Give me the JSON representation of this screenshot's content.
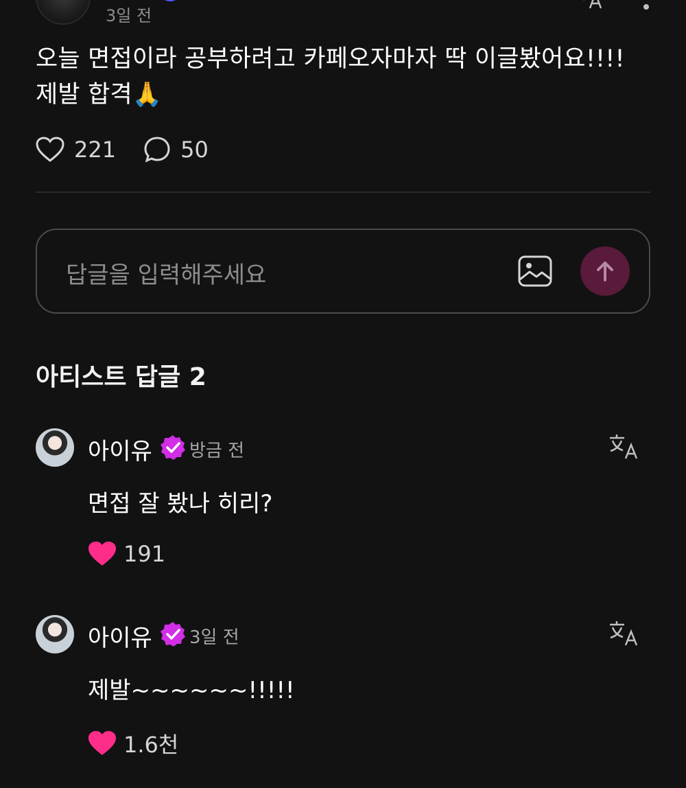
{
  "post": {
    "time": "3일 전",
    "text": "오늘 면접이라 공부하려고 카페오자마자 딱 이글봤어요!!!! 제발 합격🙏",
    "likes": "221",
    "comments": "50"
  },
  "reply_input": {
    "placeholder": "답글을 입력해주세요"
  },
  "section": {
    "title": "아티스트 답글 2"
  },
  "comments": [
    {
      "name": "아이유",
      "time": "방금 전",
      "text": "면접 잘 봤나 히리?",
      "likes": "191"
    },
    {
      "name": "아이유",
      "time": "3일 전",
      "text": "제발~~~~~~!!!!!",
      "likes": "1.6천"
    }
  ],
  "colors": {
    "background": "#121212",
    "heart": "#ff2d8a",
    "verified": "#d12ee6",
    "send_button": "#5a1a3a"
  },
  "icons": [
    "heart-outline-icon",
    "comment-icon",
    "image-icon",
    "send-arrow-icon",
    "translate-icon",
    "more-vert-icon",
    "verified-badge-icon",
    "heart-filled-icon"
  ]
}
